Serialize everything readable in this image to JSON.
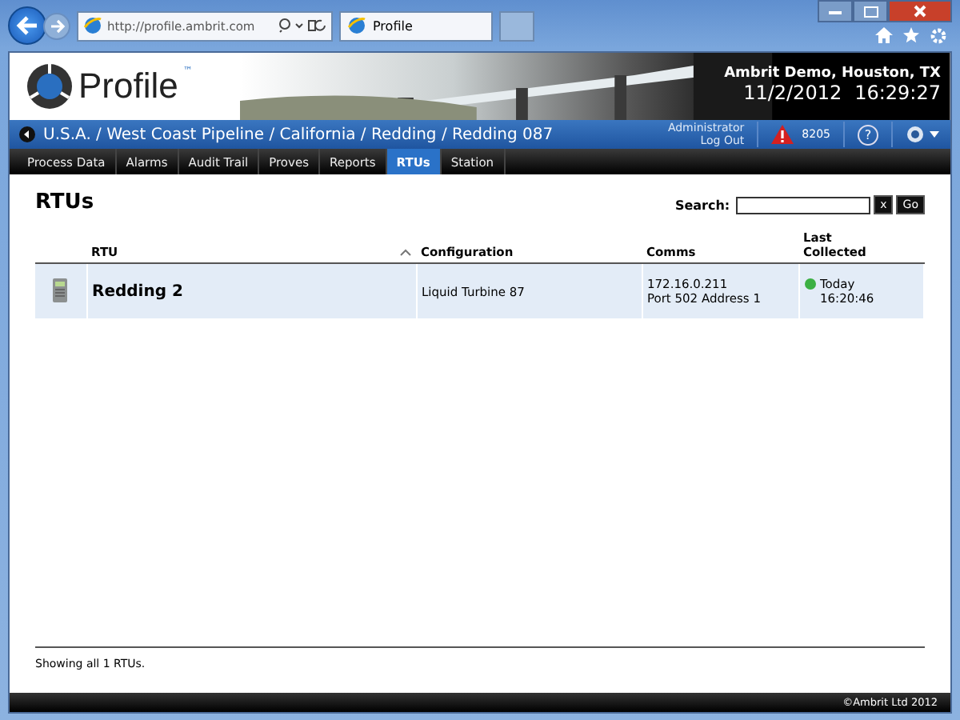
{
  "browser": {
    "address": "http://profile.ambrit.com",
    "tab_title": "Profile"
  },
  "header": {
    "logo": "Profile",
    "trademark": "™",
    "site": "Ambrit Demo, Houston, TX",
    "date": "11/2/2012",
    "time": "16:29:27"
  },
  "breadcrumb": "U.S.A. / West Coast Pipeline / California / Redding / Redding 087",
  "user": {
    "name": "Administrator",
    "logout": "Log Out",
    "alarm_count": "8205",
    "help": "?"
  },
  "tabs": [
    {
      "label": "Process Data",
      "selected": false
    },
    {
      "label": "Alarms",
      "selected": false
    },
    {
      "label": "Audit Trail",
      "selected": false
    },
    {
      "label": "Proves",
      "selected": false
    },
    {
      "label": "Reports",
      "selected": false
    },
    {
      "label": "RTUs",
      "selected": true
    },
    {
      "label": "Station",
      "selected": false
    }
  ],
  "page_title": "RTUs",
  "search": {
    "label": "Search:",
    "clear": "x",
    "go": "Go"
  },
  "table": {
    "columns": [
      "RTU",
      "Configuration",
      "Comms",
      "Last Collected"
    ],
    "rows": [
      {
        "rtu": "Redding 2",
        "configuration": "Liquid Turbine 87",
        "comms": [
          "172.16.0.211",
          "Port 502 Address 1"
        ],
        "color": "#3cb043",
        "last_collected": [
          "Today",
          "16:20:46"
        ]
      }
    ]
  },
  "summary": "Showing all 1 RTUs.",
  "copyright": "©Ambrit Ltd 2012"
}
